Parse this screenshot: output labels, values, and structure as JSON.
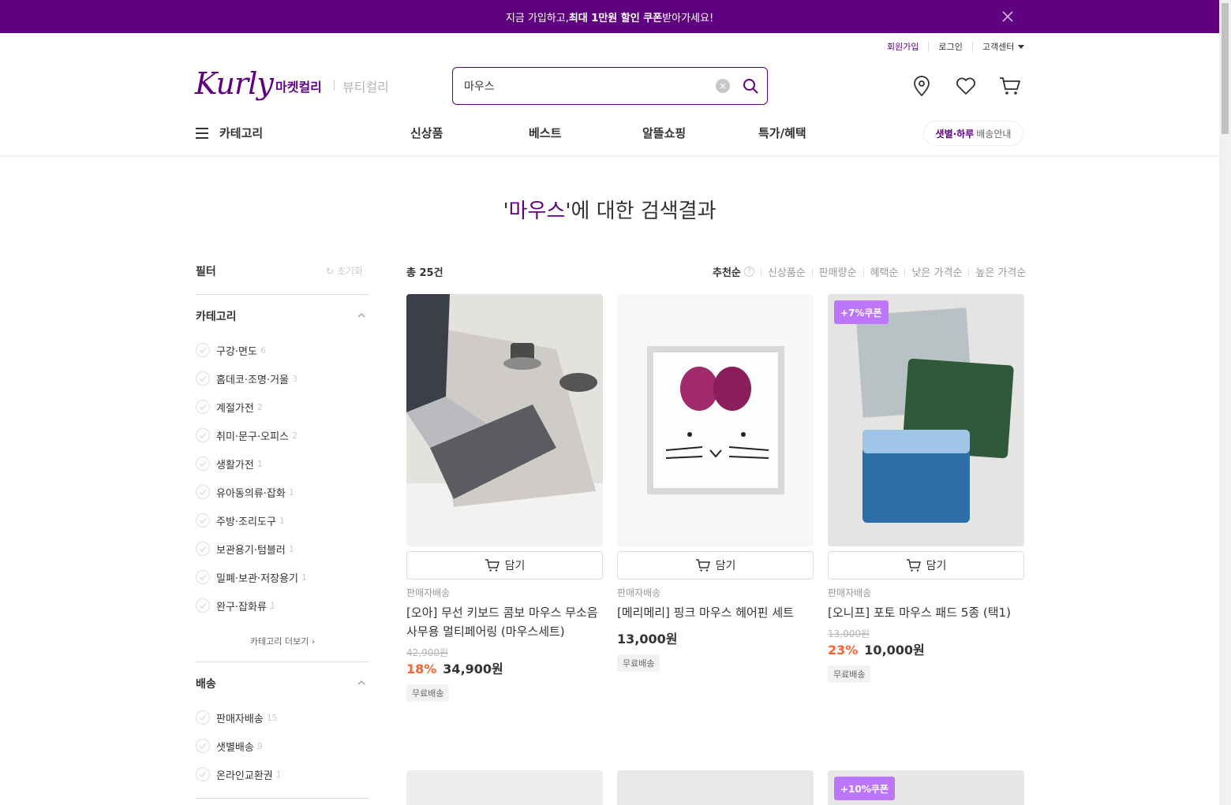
{
  "banner": {
    "pre": "지금 가입하고, ",
    "bold": "최대 1만원 할인 쿠폰",
    "post": " 받아가세요!"
  },
  "util": {
    "join": "회원가입",
    "login": "로그인",
    "support": "고객센터"
  },
  "brand": {
    "logo": "Kurly",
    "market": "마켓컬리",
    "beauty": "뷰티컬리"
  },
  "search": {
    "value": "마우스"
  },
  "gnb": {
    "category": "카테고리",
    "items": [
      "신상품",
      "베스트",
      "알뜰쇼핑",
      "특가/혜택"
    ],
    "delivery_bold": "샛별·하루",
    "delivery_rest": "배송안내"
  },
  "result": {
    "open": "'",
    "query": "마우스",
    "close": "'에 대한 검색결과"
  },
  "filter": {
    "title": "필터",
    "reset": "초기화",
    "category_title": "카테고리",
    "categories": [
      {
        "label": "구강·면도",
        "count": "6"
      },
      {
        "label": "홈데코·조명·거울",
        "count": "3"
      },
      {
        "label": "계절가전",
        "count": "2"
      },
      {
        "label": "취미·문구·오피스",
        "count": "2"
      },
      {
        "label": "생활가전",
        "count": "1"
      },
      {
        "label": "유아동의류·잡화",
        "count": "1"
      },
      {
        "label": "주방·조리도구",
        "count": "1"
      },
      {
        "label": "보관용기·텀블러",
        "count": "1"
      },
      {
        "label": "밀폐·보관·저장용기",
        "count": "1"
      },
      {
        "label": "완구·잡화류",
        "count": "1"
      }
    ],
    "more": "카테고리 더보기",
    "delivery_title": "배송",
    "delivery": [
      {
        "label": "판매자배송",
        "count": "15"
      },
      {
        "label": "샛별배송",
        "count": "9"
      },
      {
        "label": "온라인교환권",
        "count": "1"
      }
    ]
  },
  "list": {
    "total": "총 25건",
    "sorts": [
      "추천순",
      "신상품순",
      "판매량순",
      "혜택순",
      "낮은 가격순",
      "높은 가격순"
    ]
  },
  "products": [
    {
      "cart": "담기",
      "seller": "판매자배송",
      "name": "[오아] 무선 키보드 콤보 마우스 무소음 사무용 멀티페어링 (마우스세트)",
      "original": "42,900원",
      "rate": "18%",
      "price": "34,900원",
      "tag": "무료배송"
    },
    {
      "cart": "담기",
      "seller": "판매자배송",
      "name": "[메리메리] 핑크 마우스 헤어핀 세트",
      "price": "13,000원",
      "tag": "무료배송"
    },
    {
      "coupon": "+7%쿠폰",
      "cart": "담기",
      "seller": "판매자배송",
      "name": "[오니프] 포토 마우스 패드 5종 (택1)",
      "original": "13,000원",
      "rate": "23%",
      "price": "10,000원",
      "tag": "무료배송"
    }
  ],
  "next_row": {
    "coupon": "+10%쿠폰"
  }
}
